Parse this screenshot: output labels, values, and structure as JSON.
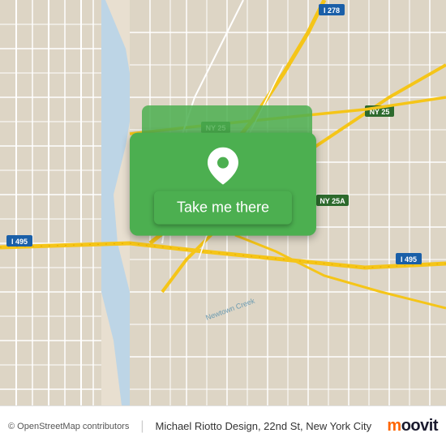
{
  "map": {
    "background_color": "#e8e0d8"
  },
  "button": {
    "label": "Take me there",
    "background_color": "#4caf50",
    "text_color": "#ffffff"
  },
  "bottom_bar": {
    "copyright": "© OpenStreetMap contributors",
    "location": "Michael Riotto Design, 22nd St, New York City",
    "logo": "moovit"
  },
  "pin": {
    "icon": "📍",
    "color": "#ffffff"
  }
}
